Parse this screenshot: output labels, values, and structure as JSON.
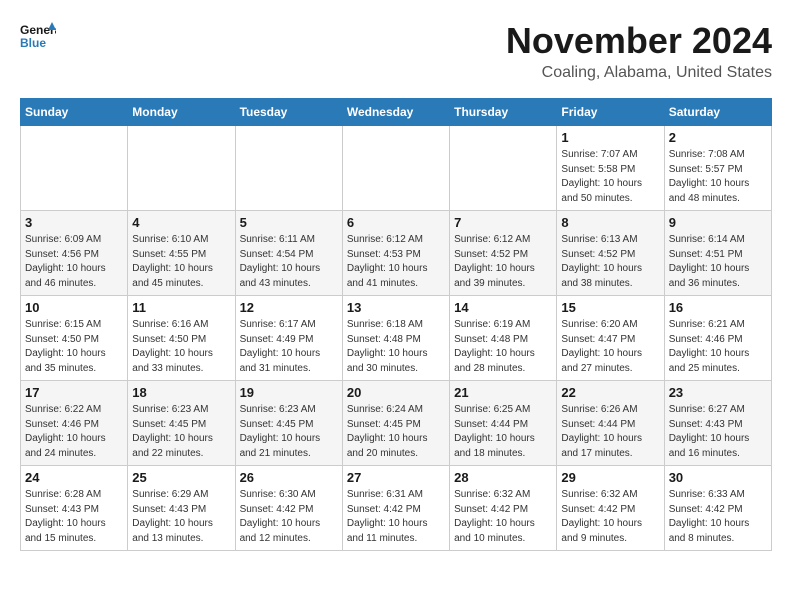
{
  "logo": {
    "line1": "General",
    "line2": "Blue"
  },
  "title": "November 2024",
  "location": "Coaling, Alabama, United States",
  "days_of_week": [
    "Sunday",
    "Monday",
    "Tuesday",
    "Wednesday",
    "Thursday",
    "Friday",
    "Saturday"
  ],
  "weeks": [
    [
      {
        "day": "",
        "info": ""
      },
      {
        "day": "",
        "info": ""
      },
      {
        "day": "",
        "info": ""
      },
      {
        "day": "",
        "info": ""
      },
      {
        "day": "",
        "info": ""
      },
      {
        "day": "1",
        "info": "Sunrise: 7:07 AM\nSunset: 5:58 PM\nDaylight: 10 hours\nand 50 minutes."
      },
      {
        "day": "2",
        "info": "Sunrise: 7:08 AM\nSunset: 5:57 PM\nDaylight: 10 hours\nand 48 minutes."
      }
    ],
    [
      {
        "day": "3",
        "info": "Sunrise: 6:09 AM\nSunset: 4:56 PM\nDaylight: 10 hours\nand 46 minutes."
      },
      {
        "day": "4",
        "info": "Sunrise: 6:10 AM\nSunset: 4:55 PM\nDaylight: 10 hours\nand 45 minutes."
      },
      {
        "day": "5",
        "info": "Sunrise: 6:11 AM\nSunset: 4:54 PM\nDaylight: 10 hours\nand 43 minutes."
      },
      {
        "day": "6",
        "info": "Sunrise: 6:12 AM\nSunset: 4:53 PM\nDaylight: 10 hours\nand 41 minutes."
      },
      {
        "day": "7",
        "info": "Sunrise: 6:12 AM\nSunset: 4:52 PM\nDaylight: 10 hours\nand 39 minutes."
      },
      {
        "day": "8",
        "info": "Sunrise: 6:13 AM\nSunset: 4:52 PM\nDaylight: 10 hours\nand 38 minutes."
      },
      {
        "day": "9",
        "info": "Sunrise: 6:14 AM\nSunset: 4:51 PM\nDaylight: 10 hours\nand 36 minutes."
      }
    ],
    [
      {
        "day": "10",
        "info": "Sunrise: 6:15 AM\nSunset: 4:50 PM\nDaylight: 10 hours\nand 35 minutes."
      },
      {
        "day": "11",
        "info": "Sunrise: 6:16 AM\nSunset: 4:50 PM\nDaylight: 10 hours\nand 33 minutes."
      },
      {
        "day": "12",
        "info": "Sunrise: 6:17 AM\nSunset: 4:49 PM\nDaylight: 10 hours\nand 31 minutes."
      },
      {
        "day": "13",
        "info": "Sunrise: 6:18 AM\nSunset: 4:48 PM\nDaylight: 10 hours\nand 30 minutes."
      },
      {
        "day": "14",
        "info": "Sunrise: 6:19 AM\nSunset: 4:48 PM\nDaylight: 10 hours\nand 28 minutes."
      },
      {
        "day": "15",
        "info": "Sunrise: 6:20 AM\nSunset: 4:47 PM\nDaylight: 10 hours\nand 27 minutes."
      },
      {
        "day": "16",
        "info": "Sunrise: 6:21 AM\nSunset: 4:46 PM\nDaylight: 10 hours\nand 25 minutes."
      }
    ],
    [
      {
        "day": "17",
        "info": "Sunrise: 6:22 AM\nSunset: 4:46 PM\nDaylight: 10 hours\nand 24 minutes."
      },
      {
        "day": "18",
        "info": "Sunrise: 6:23 AM\nSunset: 4:45 PM\nDaylight: 10 hours\nand 22 minutes."
      },
      {
        "day": "19",
        "info": "Sunrise: 6:23 AM\nSunset: 4:45 PM\nDaylight: 10 hours\nand 21 minutes."
      },
      {
        "day": "20",
        "info": "Sunrise: 6:24 AM\nSunset: 4:45 PM\nDaylight: 10 hours\nand 20 minutes."
      },
      {
        "day": "21",
        "info": "Sunrise: 6:25 AM\nSunset: 4:44 PM\nDaylight: 10 hours\nand 18 minutes."
      },
      {
        "day": "22",
        "info": "Sunrise: 6:26 AM\nSunset: 4:44 PM\nDaylight: 10 hours\nand 17 minutes."
      },
      {
        "day": "23",
        "info": "Sunrise: 6:27 AM\nSunset: 4:43 PM\nDaylight: 10 hours\nand 16 minutes."
      }
    ],
    [
      {
        "day": "24",
        "info": "Sunrise: 6:28 AM\nSunset: 4:43 PM\nDaylight: 10 hours\nand 15 minutes."
      },
      {
        "day": "25",
        "info": "Sunrise: 6:29 AM\nSunset: 4:43 PM\nDaylight: 10 hours\nand 13 minutes."
      },
      {
        "day": "26",
        "info": "Sunrise: 6:30 AM\nSunset: 4:42 PM\nDaylight: 10 hours\nand 12 minutes."
      },
      {
        "day": "27",
        "info": "Sunrise: 6:31 AM\nSunset: 4:42 PM\nDaylight: 10 hours\nand 11 minutes."
      },
      {
        "day": "28",
        "info": "Sunrise: 6:32 AM\nSunset: 4:42 PM\nDaylight: 10 hours\nand 10 minutes."
      },
      {
        "day": "29",
        "info": "Sunrise: 6:32 AM\nSunset: 4:42 PM\nDaylight: 10 hours\nand 9 minutes."
      },
      {
        "day": "30",
        "info": "Sunrise: 6:33 AM\nSunset: 4:42 PM\nDaylight: 10 hours\nand 8 minutes."
      }
    ]
  ]
}
